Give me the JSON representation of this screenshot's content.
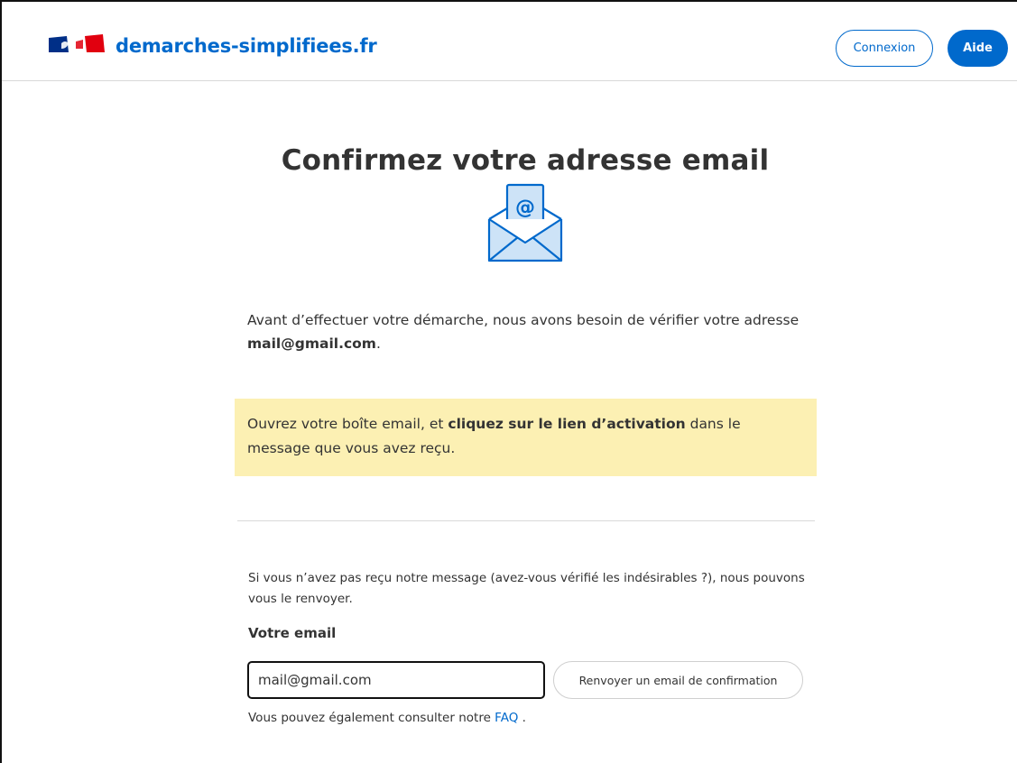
{
  "header": {
    "brand": "demarches-simplifiees.fr",
    "login_label": "Connexion",
    "help_label": "Aide"
  },
  "colors": {
    "accent": "#0069cc",
    "notice_bg": "#fcf0b3",
    "flag_blue": "#002f87",
    "flag_red": "#e1000f"
  },
  "main": {
    "title": "Confirmez votre adresse email",
    "envelope_icon": "envelope-at-icon",
    "intro_part1": "Avant d’effectuer votre démarche, nous avons besoin de vérifier votre adresse ",
    "intro_email": "mail@gmail.com",
    "intro_part2": ".",
    "notice_part1": "Ouvrez votre boîte email, et ",
    "notice_bold": "cliquez sur le lien d’activation",
    "notice_part2": " dans le message que vous avez reçu.",
    "resend_text": "Si vous n’avez pas reçu notre message (avez-vous vérifié les indésirables ?), nous pouvons vous le renvoyer.",
    "email_label": "Votre email",
    "email_value": "mail@gmail.com",
    "resend_button": "Renvoyer un email de confirmation",
    "faq_prefix": "Vous pouvez également consulter notre ",
    "faq_link": "FAQ",
    "faq_suffix": " ."
  }
}
